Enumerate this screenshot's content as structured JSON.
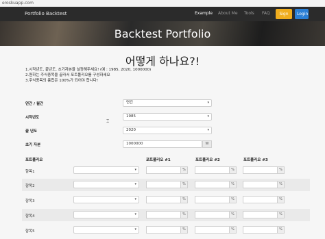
{
  "browser": {
    "url": "eroskuapp.com"
  },
  "navbar": {
    "brand": "Portfolio Backtest",
    "links": [
      "Example",
      "About Me",
      "Tools",
      "FAQ"
    ],
    "active": "Example",
    "signup": "Sign Up",
    "login": "Login"
  },
  "hero": {
    "title": "Backtest Portfolio"
  },
  "main": {
    "subtitle": "어떻게 하나요?!",
    "instructions": [
      "1.시작년도, 끝년도, 초기자본을 설정해주세요! (예 : 1985, 2020, 1000000)",
      "2.원하는 주식종목을 골라서 포트폴리오를 구성하세요",
      "3.주식종목의 총합은 100%가 되어야 합니다!"
    ]
  },
  "form": {
    "period_label": "연간 / 월간",
    "period_value": "연간",
    "start_label": "시작년도",
    "start_value": "1985",
    "end_label": "끝 년도",
    "end_value": "2020",
    "capital_label": "초기 자본",
    "capital_value": "1000000",
    "capital_unit": "W"
  },
  "portfolio": {
    "header": "포트폴리오",
    "columns": [
      "포트폴리오 #1",
      "포트폴리오 #2",
      "포트폴리오 #3"
    ],
    "items": [
      "항목1",
      "항목2",
      "항목3",
      "항목4",
      "항목5"
    ],
    "percent_suffix": "%"
  },
  "colors": {
    "navbar": "#2b2b2b",
    "signup": "#f0ad1e",
    "login": "#2a7fd6"
  }
}
